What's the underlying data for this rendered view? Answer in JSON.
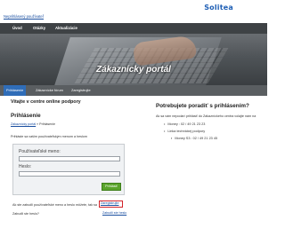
{
  "header": {
    "unauth_link": "Neprihlásený používateľ",
    "logo": "Solitea"
  },
  "nav": {
    "items": [
      "Úvod",
      "Otázky",
      "Aktualizácie"
    ]
  },
  "hero": {
    "title": "Zákaznícky portál"
  },
  "subnav": {
    "items": [
      "Prihlásenie",
      "Zákaznícke fórum",
      "Zaregistrujte"
    ]
  },
  "login": {
    "welcome": "Vitajte v centre online podpory",
    "heading": "Prihlásenie",
    "breadcrumb_home": "Zákaznícky portál",
    "breadcrumb_sep": " » ",
    "breadcrumb_current": "Prihlásenie",
    "intro": "Prihláste sa vašim používateľským menom a heslom",
    "username_label": "Používateľské meno:",
    "username_value": "",
    "password_label": "Heslo:",
    "password_value": "",
    "submit_label": "Prihlásiť",
    "forgot_text": "Ak ste zabudli používateľské meno a heslo môžete, tak sa",
    "forgot_link": "Zaregistrujte",
    "forgot_id_text": "Zabudli ste heslo?",
    "forgot_id_link": "Zabudli ste heslo"
  },
  "help": {
    "heading": "Potrebujete poradiť s prihlásením?",
    "text": "Ak sa vám nepodarí prihlásiť do Zákazníckeho centra volajte nám na",
    "contacts": [
      "Money : 02 / 49 21 23 23",
      "Linka technickej podpory",
      "Money S3 : 02 / 49 21 23 45"
    ]
  },
  "colors": {
    "brand": "#1f5fb5",
    "nav_bg": "#3e4245",
    "subnav_active": "#2f6db8",
    "button": "#5aa42c",
    "highlight": "#d2232a"
  }
}
